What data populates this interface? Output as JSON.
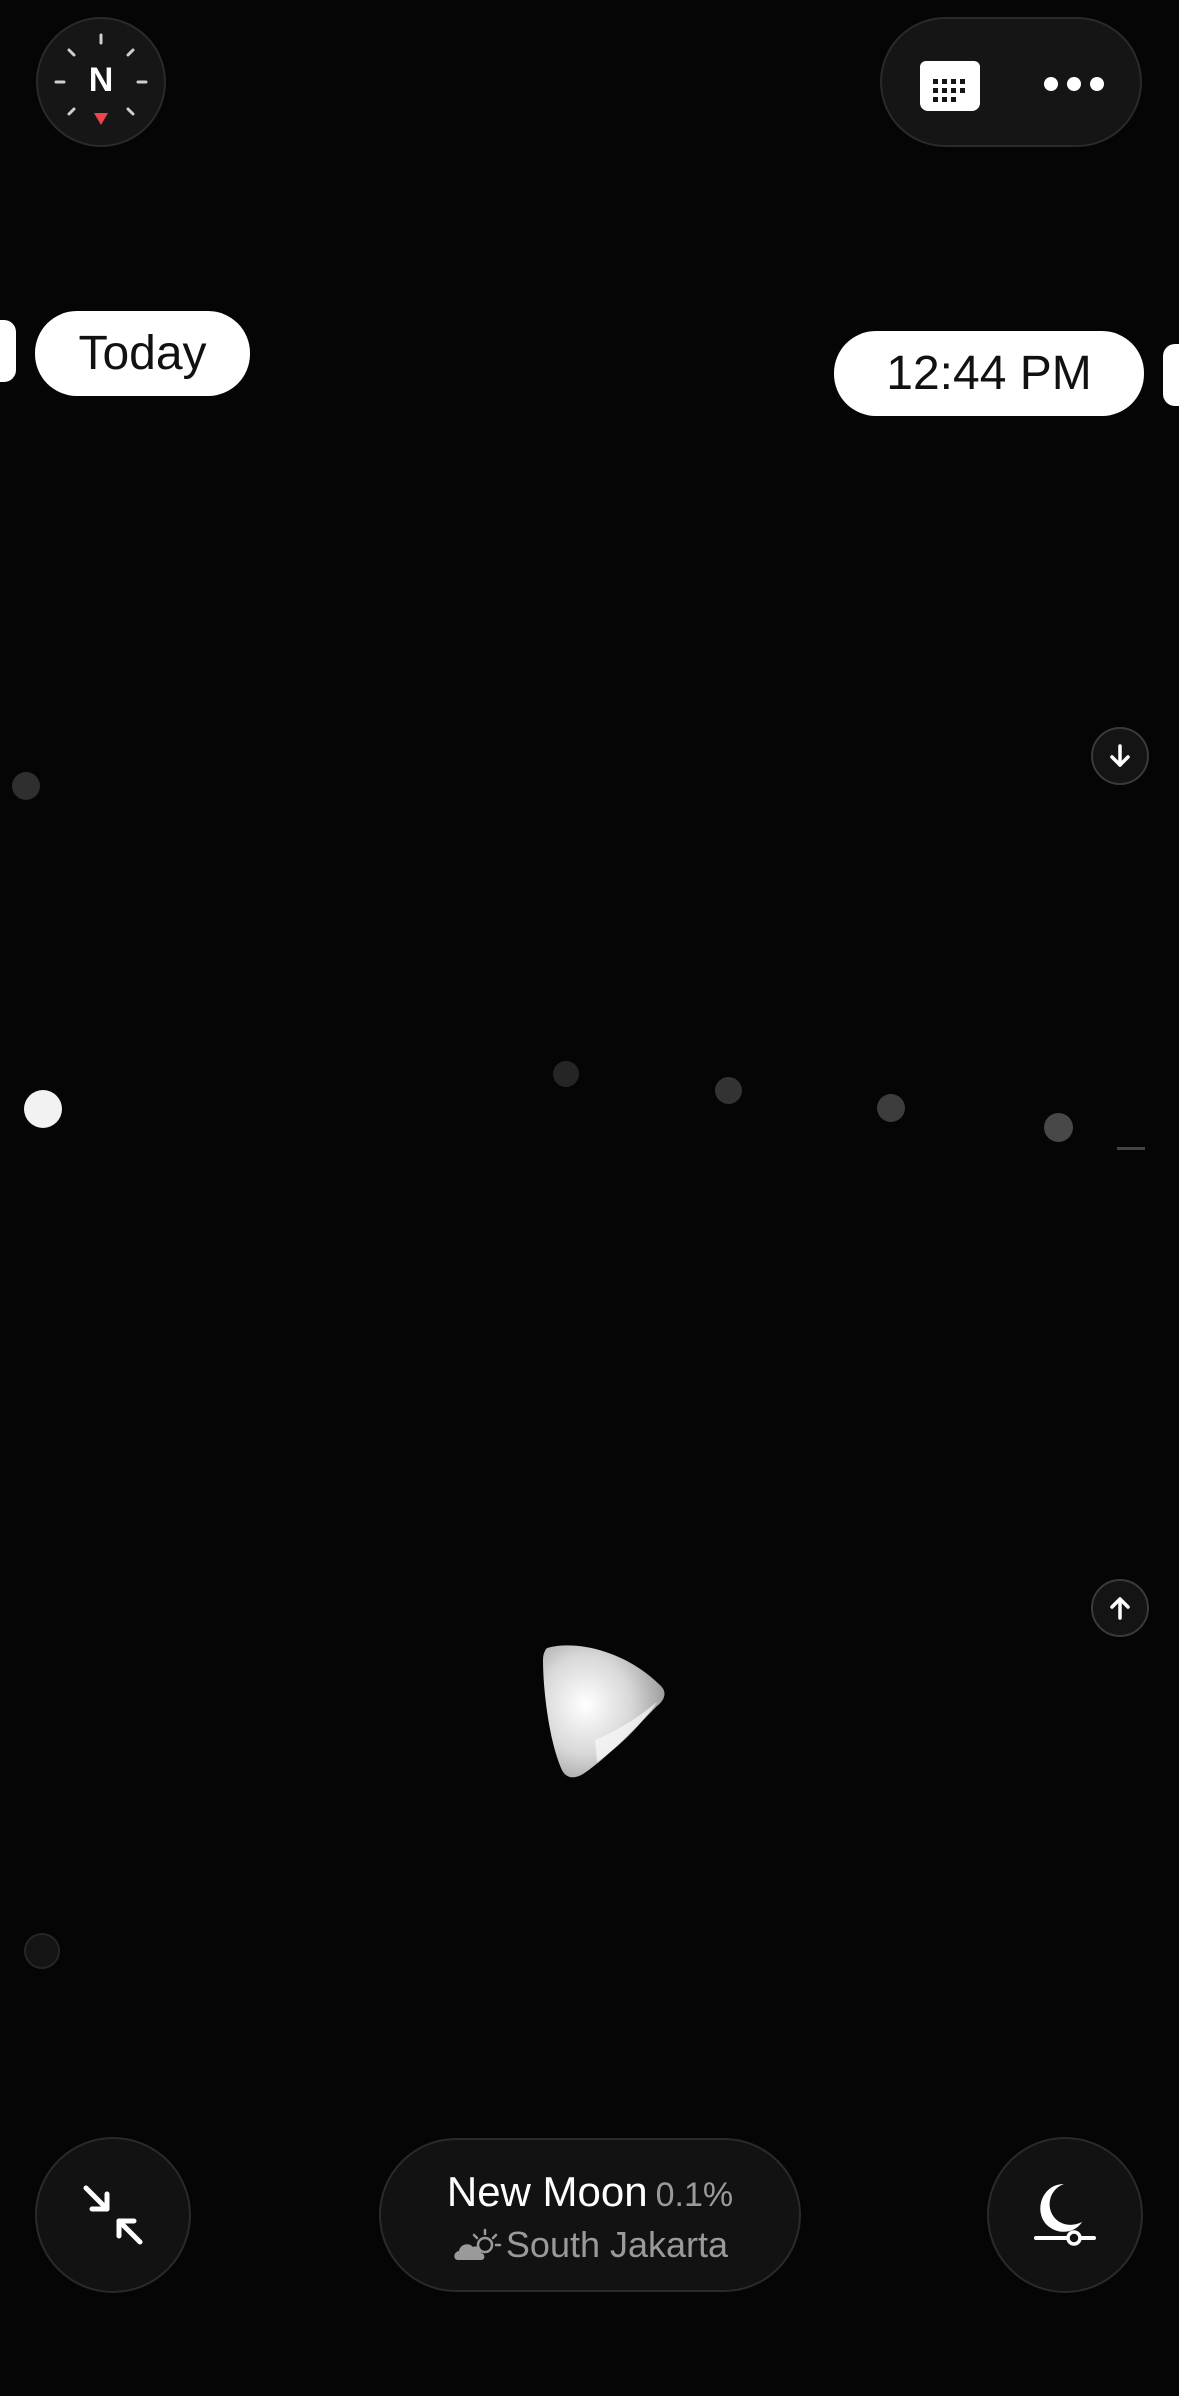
{
  "compass": {
    "heading_label": "N",
    "icon": "compass-icon"
  },
  "toolbar": {
    "calendar_icon": "calendar-icon",
    "more_icon": "more-icon"
  },
  "date_label": "Today",
  "time_label": "12:44 PM",
  "moon": {
    "phase_name": "New Moon",
    "illumination": "0.1%",
    "weather_icon": "partly-cloudy-icon",
    "location": "South Jakarta"
  },
  "controls": {
    "scroll_down_icon": "arrow-down-icon",
    "scroll_up_icon": "arrow-up-icon",
    "collapse_icon": "collapse-icon",
    "moon_settings_icon": "moon-slider-icon"
  },
  "colors": {
    "background": "#050505",
    "pill_white": "#ffffff",
    "compass_needle": "#e8464a",
    "secondary_text": "#9a9a9a"
  }
}
